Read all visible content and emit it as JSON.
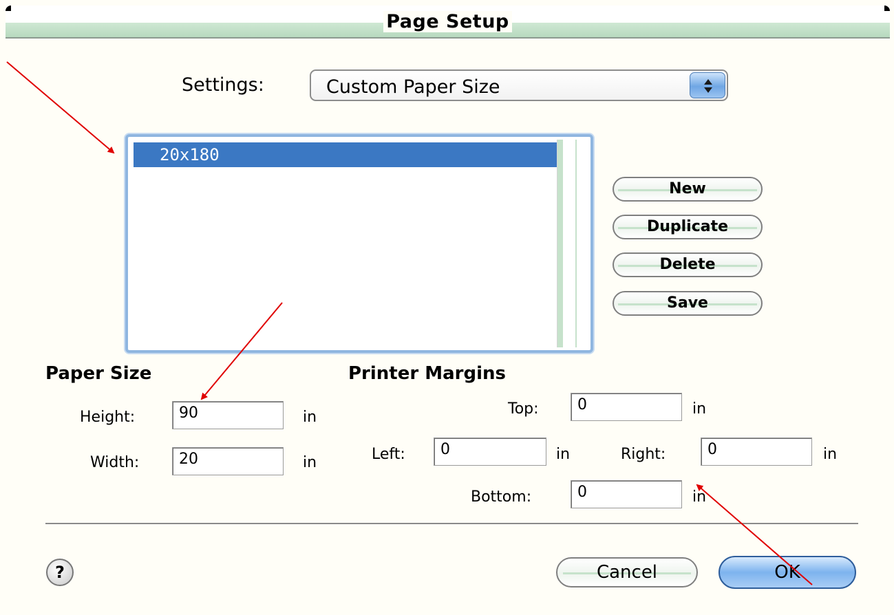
{
  "window": {
    "title": "Page Setup"
  },
  "settings": {
    "label": "Settings:",
    "value": "Custom Paper Size"
  },
  "paper_list": {
    "items": [
      "20x180"
    ],
    "selected": "20x180"
  },
  "buttons": {
    "new": "New",
    "duplicate": "Duplicate",
    "delete": "Delete",
    "save": "Save"
  },
  "paper_size": {
    "heading": "Paper Size",
    "height_label": "Height:",
    "height_value": "90",
    "height_unit": "in",
    "width_label": "Width:",
    "width_value": "20",
    "width_unit": "in"
  },
  "margins": {
    "heading": "Printer Margins",
    "top_label": "Top:",
    "top_value": "0",
    "top_unit": "in",
    "left_label": "Left:",
    "left_value": "0",
    "left_unit": "in",
    "right_label": "Right:",
    "right_value": "0",
    "right_unit": "in",
    "bottom_label": "Bottom:",
    "bottom_value": "0",
    "bottom_unit": "in"
  },
  "footer": {
    "help": "?",
    "cancel": "Cancel",
    "ok": "OK"
  },
  "colors": {
    "selection": "#3b78c3",
    "arrow": "#e00000",
    "default_button": "#7db3ee"
  }
}
